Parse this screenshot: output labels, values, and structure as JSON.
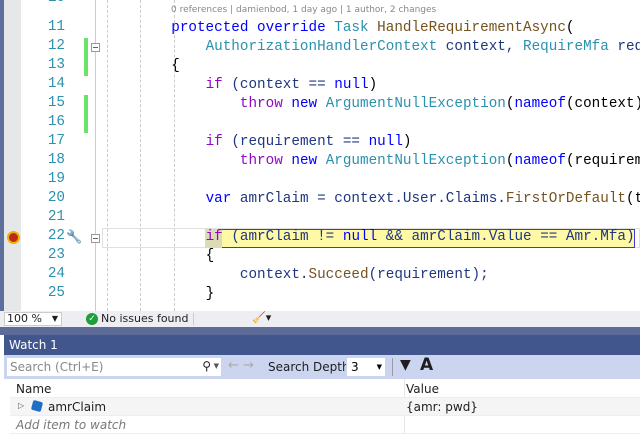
{
  "editor": {
    "codelens": "0 references | damienbod, 1 day ago | 1 author, 2 changes",
    "lines": [
      {
        "n": "11",
        "t": [
          [
            "        "
          ],
          [
            "protected override ",
            "kw"
          ],
          [
            "Task ",
            "ty"
          ],
          [
            "HandleRequirementAsync",
            "fn"
          ],
          [
            "(",
            "pl"
          ]
        ]
      },
      {
        "n": "12",
        "t": [
          [
            "            "
          ],
          [
            "AuthorizationHandlerContext ",
            "ty"
          ],
          [
            "context, "
          ],
          [
            "RequireMfa ",
            "ty"
          ],
          [
            "req"
          ]
        ]
      },
      {
        "n": "13",
        "t": [
          [
            "        "
          ],
          [
            "{",
            "pl"
          ]
        ]
      },
      {
        "n": "14",
        "t": [
          [
            "            "
          ],
          [
            "if ",
            "ctl"
          ],
          [
            "(context == "
          ],
          [
            "null",
            "kw"
          ],
          [
            ")",
            "pl"
          ]
        ]
      },
      {
        "n": "15",
        "t": [
          [
            "                "
          ],
          [
            "throw ",
            "ctl"
          ],
          [
            "new ",
            "kw"
          ],
          [
            "ArgumentNullException",
            "ty"
          ],
          [
            "(",
            "pl"
          ],
          [
            "nameof",
            "kw"
          ],
          [
            "(context)",
            "pl"
          ]
        ]
      },
      {
        "n": "16",
        "t": [
          [
            ""
          ]
        ]
      },
      {
        "n": "17",
        "t": [
          [
            "            "
          ],
          [
            "if ",
            "ctl"
          ],
          [
            "(requirement == "
          ],
          [
            "null",
            "kw"
          ],
          [
            ")",
            "pl"
          ]
        ]
      },
      {
        "n": "18",
        "t": [
          [
            "                "
          ],
          [
            "throw ",
            "ctl"
          ],
          [
            "new ",
            "kw"
          ],
          [
            "ArgumentNullException",
            "ty"
          ],
          [
            "(",
            "pl"
          ],
          [
            "nameof",
            "kw"
          ],
          [
            "(requiremen",
            "pl"
          ]
        ]
      },
      {
        "n": "19",
        "t": [
          [
            ""
          ]
        ]
      },
      {
        "n": "20",
        "t": [
          [
            "            "
          ],
          [
            "var ",
            "kw"
          ],
          [
            "amrClaim = context.User.Claims."
          ],
          [
            "FirstOrDefault",
            "fn"
          ],
          [
            "(t",
            "pl"
          ]
        ]
      },
      {
        "n": "21",
        "t": [
          [
            ""
          ]
        ]
      },
      {
        "n": "22",
        "t": [
          [
            "            "
          ],
          [
            "if ",
            "ctl"
          ],
          [
            "(amrClaim != "
          ],
          [
            "null ",
            "kw"
          ],
          [
            "&& amrClaim.Value == Amr.Mfa)"
          ]
        ]
      },
      {
        "n": "23",
        "t": [
          [
            "            "
          ],
          [
            "{",
            "pl"
          ]
        ]
      },
      {
        "n": "24",
        "t": [
          [
            "                "
          ],
          [
            "context."
          ],
          [
            "Succeed",
            "fn"
          ],
          [
            "(requirement);"
          ]
        ]
      },
      {
        "n": "25",
        "t": [
          [
            "            "
          ],
          [
            "}",
            "pl"
          ]
        ]
      }
    ]
  },
  "status": {
    "zoom": "100 %",
    "issues": "No issues found"
  },
  "watch": {
    "title": "Watch 1",
    "search_placeholder": "Search (Ctrl+E)",
    "search_depth_label": "Search Depth:",
    "search_depth": "3",
    "columns": {
      "name": "Name",
      "value": "Value"
    },
    "rows": [
      {
        "name": "amrClaim",
        "value": "{amr: pwd}"
      }
    ],
    "add_item": "Add item to watch"
  }
}
